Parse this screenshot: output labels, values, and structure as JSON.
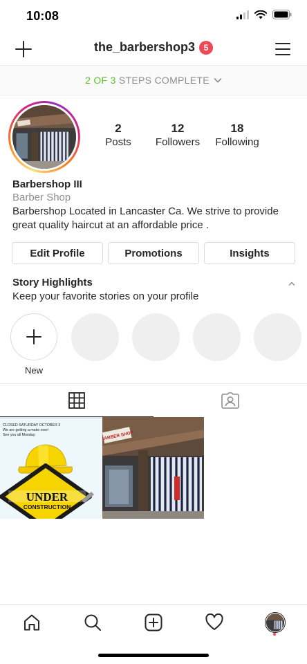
{
  "status_bar": {
    "time": "10:08"
  },
  "nav": {
    "username": "the_barbershop3",
    "notification_count": "5"
  },
  "steps": {
    "progress_text": "2 OF 3",
    "suffix_text": " STEPS COMPLETE",
    "steps_completed": 2,
    "steps_total": 3
  },
  "stats": [
    {
      "value": "2",
      "label": "Posts"
    },
    {
      "value": "12",
      "label": "Followers"
    },
    {
      "value": "18",
      "label": "Following"
    }
  ],
  "bio": {
    "name": "Barbershop III",
    "category": "Barber Shop",
    "description": "Barbershop Located in Lancaster Ca. We strive to provide great quality haircut at an affordable price ."
  },
  "actions": {
    "edit_profile": "Edit Profile",
    "promotions": "Promotions",
    "insights": "Insights"
  },
  "highlights": {
    "title": "Story Highlights",
    "subtitle": "Keep your favorite stories on your profile",
    "new_label": "New"
  },
  "posts": {
    "post1": {
      "line1": "CLOSED SATURDAY OCTOBER 3",
      "line2": "We are getting a make over!",
      "line3": "See you all Monday.",
      "sign_top": "UNDER",
      "sign_bottom": "CONSTRUCTION"
    },
    "post2": {
      "shop_sign": "BARBER SHOP"
    }
  },
  "colors": {
    "accent_green": "#58c322",
    "badge_red": "#ed4956",
    "text_dark": "#262626",
    "text_gray": "#8e8e8e",
    "border": "#dbdbdb"
  },
  "icons": {
    "nav_left": "plus-icon",
    "nav_right": "hamburger-menu-icon",
    "tab_grid": "grid-icon",
    "tab_tagged": "tagged-person-icon",
    "bottom_nav": [
      "home-icon",
      "search-icon",
      "new-post-icon",
      "heart-icon",
      "profile-avatar"
    ]
  }
}
